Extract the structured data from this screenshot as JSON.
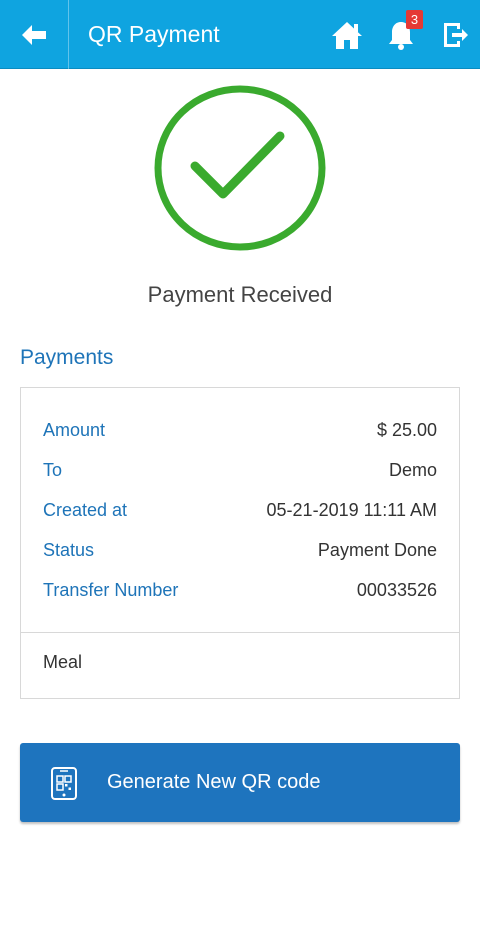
{
  "header": {
    "title": "QR Payment",
    "notification_count": "3",
    "back_icon": "arrow-left-icon",
    "home_icon": "home-icon",
    "bell_icon": "bell-icon",
    "exit_icon": "logout-icon",
    "bar_color": "#0fa4e0"
  },
  "result": {
    "icon": "checkmark-circle-icon",
    "icon_color": "#3aaa2e",
    "message": "Payment Received"
  },
  "payments": {
    "title": "Payments",
    "rows": [
      {
        "label": "Amount",
        "value": "$ 25.00"
      },
      {
        "label": "To",
        "value": "Demo"
      },
      {
        "label": "Created at",
        "value": "05-21-2019 11:11 AM"
      },
      {
        "label": "Status",
        "value": "Payment Done"
      },
      {
        "label": "Transfer Number",
        "value": "00033526"
      }
    ],
    "note": "Meal"
  },
  "actions": {
    "generate_label": "Generate New QR code",
    "generate_icon": "qr-phone-icon",
    "button_color": "#1e74be"
  }
}
